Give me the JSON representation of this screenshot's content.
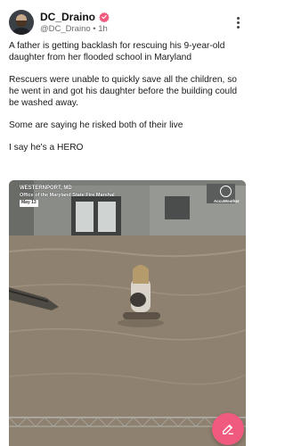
{
  "author": {
    "display_name": "DC_Draino",
    "handle": "@DC_Draino",
    "separator": "•",
    "time": "1h",
    "verified": true,
    "avatar_icon": "avatar-photo-icon"
  },
  "post": {
    "paragraphs": [
      "A father is getting backlash for rescuing his 9-year-old daughter from her flooded school in Maryland",
      "Rescuers were unable to quickly save all the children, so he went in and got his daughter before the building could be washed away.",
      "Some are saying he risked both of their live",
      "I say he's a HERO"
    ]
  },
  "media": {
    "location": "WESTERNPORT, MD",
    "credit": "Office of the Maryland State Fire Marshal",
    "date": "May 13",
    "brand": "AccuWeather"
  },
  "colors": {
    "accent": "#f05a7e",
    "verified_badge": "#f05a7e",
    "text_secondary": "#6b6b6b"
  },
  "icons": {
    "more": "more-vertical-icon",
    "compose": "compose-icon",
    "verified": "verified-badge-icon"
  }
}
